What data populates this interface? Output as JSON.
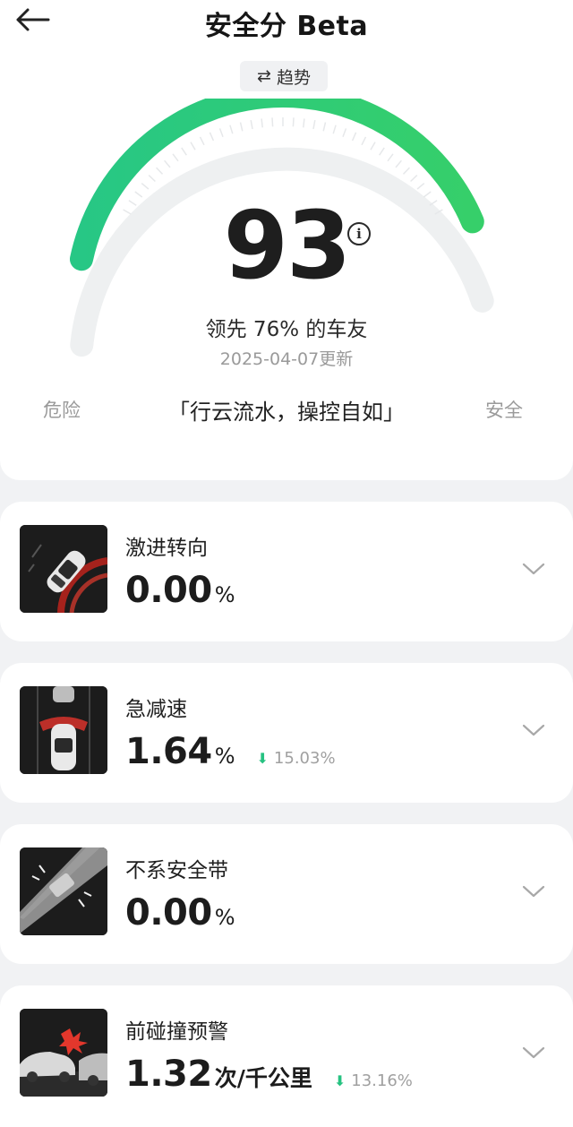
{
  "header": {
    "title": "安全分 Beta",
    "back_icon": "arrow-left-icon"
  },
  "trend_button": {
    "label": "趋势",
    "icon": "swap-arrows-icon"
  },
  "gauge": {
    "score": "93",
    "level_fraction": 0.93,
    "color_start": "#27c785",
    "color_end": "#2fd06a",
    "rank_text": "领先 76% 的车友",
    "updated_text": "2025-04-07更新",
    "low_label": "危险",
    "high_label": "安全",
    "slogan": "「行云流水，操控自如」"
  },
  "metrics": [
    {
      "title": "激进转向",
      "value": "0.00",
      "unit": "%",
      "change": "",
      "icon": "aggressive-steering-icon"
    },
    {
      "title": "急减速",
      "value": "1.64",
      "unit": "%",
      "change": "15.03%",
      "icon": "hard-braking-icon"
    },
    {
      "title": "不系安全带",
      "value": "0.00",
      "unit": "%",
      "change": "",
      "icon": "seatbelt-icon"
    },
    {
      "title": "前碰撞预警",
      "value": "1.32",
      "unit": "次/千公里",
      "change": "13.16%",
      "icon": "collision-warning-icon"
    }
  ],
  "colors": {
    "accent": "#26c281",
    "background": "#f1f2f4",
    "card": "#ffffff"
  }
}
